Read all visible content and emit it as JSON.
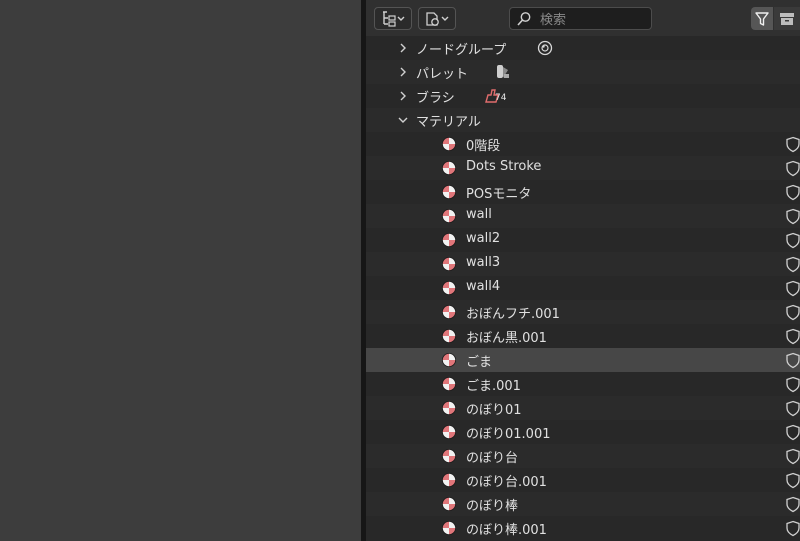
{
  "header": {
    "search_placeholder": "検索"
  },
  "categories": [
    {
      "label": "ノードグループ",
      "icon": "node-group-icon",
      "expanded": false
    },
    {
      "label": "パレット",
      "icon": "palette-icon",
      "expanded": false
    },
    {
      "label": "ブラシ",
      "icon": "brush-icon",
      "expanded": false,
      "badge": "74"
    },
    {
      "label": "マテリアル",
      "icon": "",
      "expanded": true
    }
  ],
  "materials": [
    "0階段",
    "Dots Stroke",
    "POSモニタ",
    "wall",
    "wall2",
    "wall3",
    "wall4",
    "おぼんフチ.001",
    "おぼん黒.001",
    "ごま",
    "ごま.001",
    "のぼり01",
    "のぼり01.001",
    "のぼり台",
    "のぼり台.001",
    "のぼり棒",
    "のぼり棒.001"
  ],
  "selected_material": "ごま",
  "colors": {
    "material_icon": "#e0767a",
    "brush_icon": "#e06c6c",
    "selected_row": "#474747"
  }
}
